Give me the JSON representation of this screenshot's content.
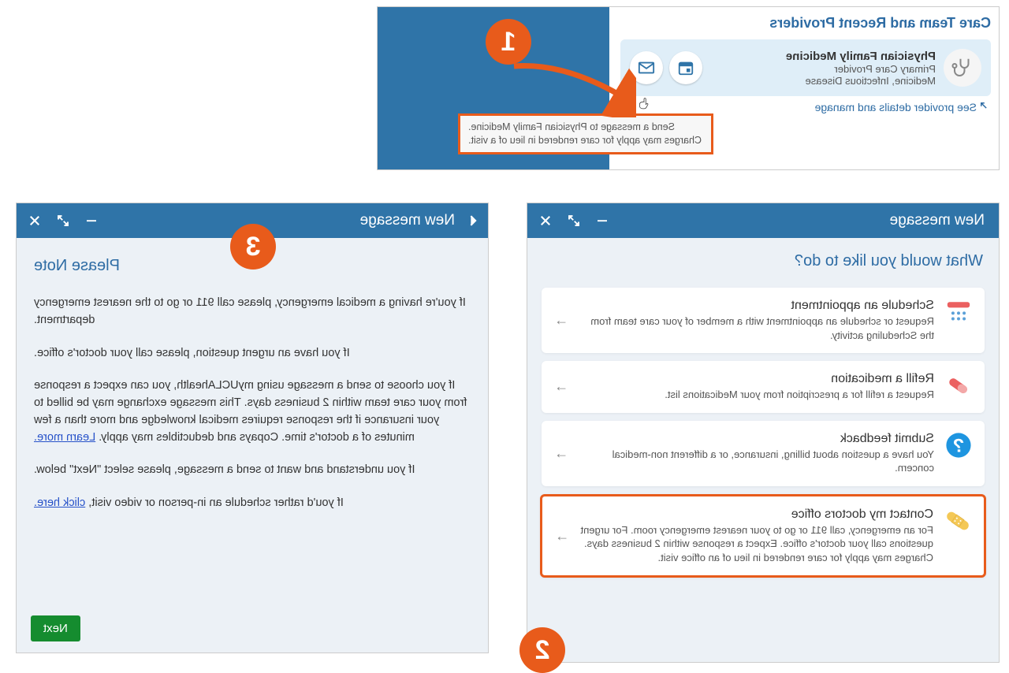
{
  "panel1": {
    "title": "Care Team and Recent Providers",
    "provider": {
      "name": "Physician Family Medicine",
      "role": "Primary Care Provider",
      "specialty": "Medicine, Infectious Disease"
    },
    "see_details": "See provider details and manage",
    "tooltip_line1": "Send a message to Physician Family Medicine.",
    "tooltip_line2": "Charges may apply for care rendered in lieu of a visit."
  },
  "badges": {
    "b1": "1",
    "b2": "2",
    "b3": "3"
  },
  "panel2": {
    "header": "New message",
    "question": "What would you like to do?",
    "options": [
      {
        "title": "Schedule an appointment",
        "desc": "Request or schedule an appointment with a member of your care team from the Scheduling activity.",
        "icon": "calendar-icon"
      },
      {
        "title": "Refill a medication",
        "desc": "Request a refill for a prescription from your Medications list.",
        "icon": "pill-icon"
      },
      {
        "title": "Submit feedback",
        "desc": "You have a question about billing, insurance, or a different non-medical concern.",
        "icon": "question-icon"
      },
      {
        "title": "Contact my doctors office",
        "desc": "For an emergency, call 911 or go to your nearest emergency room. For urgent questions call your doctor's office. Expect a response within 2 business days. Charges may apply for care rendered in lieu of an office visit.",
        "icon": "bandage-icon"
      }
    ]
  },
  "panel3": {
    "header": "New message",
    "title": "Please Note",
    "p1": "If you're having a medical emergency, please call 911 or go to the nearest emergency department.",
    "p2": "If you have an urgent question, please call your doctor's office.",
    "p3a": "If you choose to send a message using myUCLAhealth, you can expect a response from your care team within 2 business days. This message exchange may be billed to your insurance if the response requires medical knowledge and more than a few minutes of a doctor's time. Copays and deductibles may apply. ",
    "p3link": "Learn more.",
    "p4": "If you understand and want to send a message, please select \"Next\" below.",
    "p5a": "If you'd rather schedule an in-person or video visit, ",
    "p5link": "click here.",
    "next": "Next"
  }
}
